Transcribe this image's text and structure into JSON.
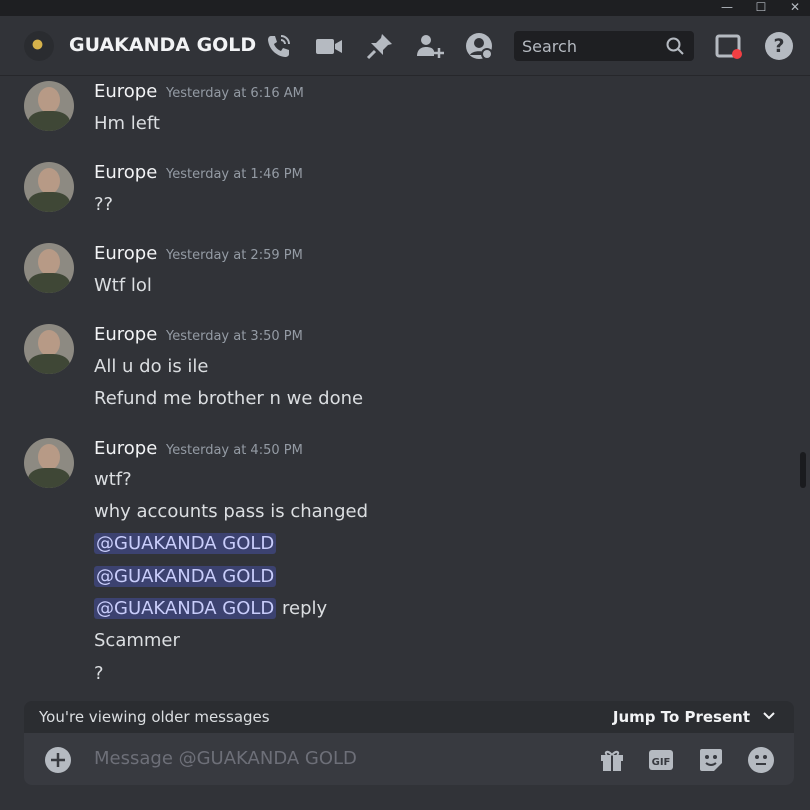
{
  "window": {
    "minimize": "—",
    "maximize": "☐",
    "close": "✕"
  },
  "header": {
    "title": "GUAKANDA GOLD",
    "search_placeholder": "Search",
    "icons": [
      "phone-call-icon",
      "video-icon",
      "pin-icon",
      "add-friend-icon",
      "profile-icon",
      "search-icon",
      "inbox-icon",
      "help-icon"
    ]
  },
  "messages": [
    {
      "author": "Europe",
      "time": "Yesterday at 6:16 AM",
      "lines": [
        "Hm left"
      ]
    },
    {
      "author": "Europe",
      "time": "Yesterday at 1:46 PM",
      "lines": [
        "??"
      ]
    },
    {
      "author": "Europe",
      "time": "Yesterday at 2:59 PM",
      "lines": [
        "Wtf lol"
      ]
    },
    {
      "author": "Europe",
      "time": "Yesterday at 3:50 PM",
      "lines": [
        "All u do is ile",
        "Refund me brother n we done"
      ]
    },
    {
      "author": "Europe",
      "time": "Yesterday at 4:50 PM",
      "lines": [
        "wtf?",
        "why accounts pass is changed"
      ],
      "mentions": [
        "@GUAKANDA GOLD",
        "@GUAKANDA GOLD",
        "@GUAKANDA GOLD"
      ],
      "mention_suffix": "reply",
      "after": [
        "Scammer",
        "?"
      ]
    }
  ],
  "older_bar": {
    "text": "You're viewing older messages",
    "jump": "Jump To Present"
  },
  "composer": {
    "placeholder": "Message @GUAKANDA GOLD",
    "gif_label": "GIF"
  },
  "colors": {
    "background": "#313338",
    "mention_bg": "#3c4270",
    "mention_text": "#c9cdfb",
    "unread_dot": "#f23f43"
  }
}
